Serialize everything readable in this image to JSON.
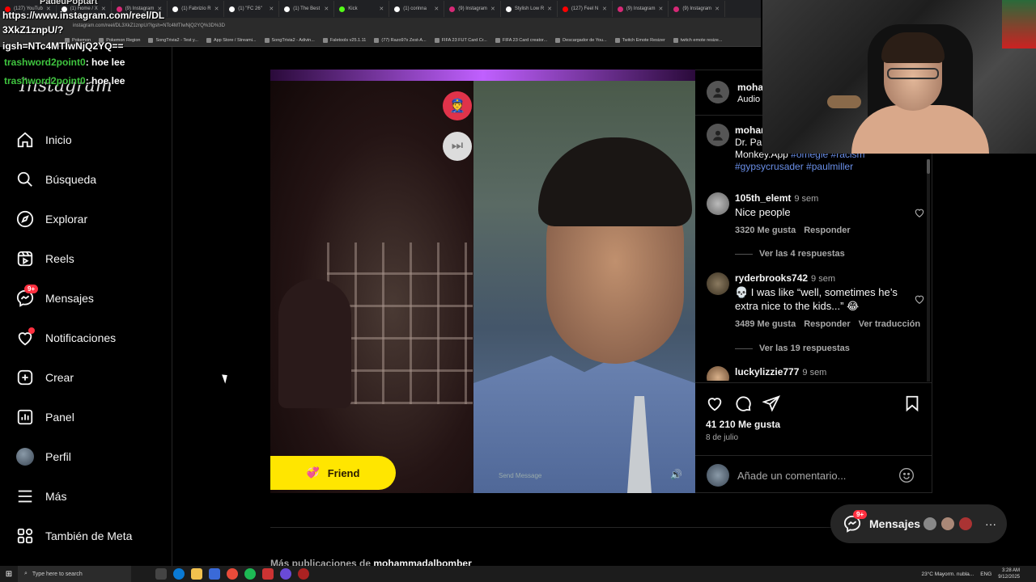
{
  "browser": {
    "tabs": [
      {
        "label": "(127) YouTub",
        "color": "#ff0000"
      },
      {
        "label": "(1) Home / X",
        "color": "#ffffff"
      },
      {
        "label": "(9) Instagram",
        "color": "#d62976"
      },
      {
        "label": "(1) Fabrizio R",
        "color": "#ffffff"
      },
      {
        "label": "(1) \"FC 26\"",
        "color": "#ffffff"
      },
      {
        "label": "(1) The Best",
        "color": "#ffffff"
      },
      {
        "label": "Kick",
        "color": "#53fc18"
      },
      {
        "label": "(1) corinna",
        "color": "#ffffff"
      },
      {
        "label": "(9) Instagram",
        "color": "#d62976"
      },
      {
        "label": "Stylish Low R",
        "color": "#ffffff"
      },
      {
        "label": "(127) Feel N",
        "color": "#ff0000"
      },
      {
        "label": "(9) Instagram",
        "color": "#d62976"
      },
      {
        "label": "(9) Instagram",
        "color": "#d62976"
      }
    ],
    "url": "instagram.com/reel/DL3XkZ1znpU/?igsh=NTc4MTIwNjQ2YQ%3D%3D",
    "bookmarks": [
      "Pokemon",
      "Pokemon Region",
      "SongTrivia2 - Test y...",
      "App Store / Streami...",
      "SongTrivia2 - Adivin...",
      "Faletools v25.1.11",
      "(77) Razo97x Zest-A...",
      "FIFA 23 FUT Card Cr...",
      "FIFA 23 Card creator...",
      "Descargador de You...",
      "Twitch Emote Resizer",
      "twitch emote resize..."
    ]
  },
  "overlay": {
    "user": "PadeuPoptart",
    "url_line1": "https://www.instagram.com/reel/DL",
    "url_line2": "3XkZ1znpU/?",
    "url_line3": "igsh=NTc4MTIwNjQ2YQ==",
    "chat": [
      {
        "name": "trashword2point0",
        "msg": ": hoe lee"
      },
      {
        "name": "trashword2point0",
        "msg": ": hoe lee"
      }
    ]
  },
  "sidebar": {
    "logo": "Instagram",
    "items": [
      {
        "label": "Inicio",
        "icon": "home-icon"
      },
      {
        "label": "Búsqueda",
        "icon": "search-icon"
      },
      {
        "label": "Explorar",
        "icon": "compass-icon"
      },
      {
        "label": "Reels",
        "icon": "reels-icon"
      },
      {
        "label": "Mensajes",
        "icon": "messenger-icon",
        "badge": "9+"
      },
      {
        "label": "Notificaciones",
        "icon": "heart-icon"
      },
      {
        "label": "Crear",
        "icon": "plus-square-icon"
      },
      {
        "label": "Panel",
        "icon": "chart-icon"
      },
      {
        "label": "Perfil",
        "icon": "avatar"
      },
      {
        "label": "Más",
        "icon": "menu-icon"
      },
      {
        "label": "También de Meta",
        "icon": "meta-grid-icon"
      }
    ]
  },
  "video": {
    "friend_label": "Friend",
    "send_placeholder": "Send Message",
    "police_icon": "police-emoji-icon",
    "skip_icon": "skip-icon"
  },
  "post": {
    "author": "moha",
    "audio": "Audio",
    "caption_user": "mohan",
    "caption_line1": "Dr. Pa",
    "caption_line2": "Monkey.App",
    "hashtags_line2": "#omegle #racism",
    "hashtags_line3": "#gypsycrusader #paulmiller",
    "comments": [
      {
        "user": "105th_elemt",
        "time": "9 sem",
        "text": "Nice people",
        "likes": "3320 Me gusta",
        "reply": "Responder",
        "translate": "",
        "replies": "Ver las 4 respuestas"
      },
      {
        "user": "ryderbrooks742",
        "time": "9 sem",
        "text": "💀 I was like “well, sometimes he’s extra nice to the kids...” 😂",
        "likes": "3489 Me gusta",
        "reply": "Responder",
        "translate": "Ver traducción",
        "replies": "Ver las 19 respuestas"
      },
      {
        "user": "luckylizzie777",
        "time": "9 sem",
        "text": "",
        "likes": "",
        "reply": "",
        "translate": "",
        "replies": ""
      }
    ],
    "total_likes": "41 210 Me gusta",
    "date": "8 de julio",
    "comment_placeholder": "Añade un comentario..."
  },
  "bottom": {
    "more_prefix": "Más publicaciones de",
    "more_user": "mohammadalbomber",
    "messages_label": "Mensajes",
    "messages_badge": "9+"
  },
  "taskbar": {
    "search_placeholder": "Type here to search",
    "weather": "23°C  Mayorm. nubla...",
    "lang": "ENG",
    "time": "3:28 AM",
    "date": "9/12/2025"
  },
  "colors": {
    "accent_red": "#ff3040",
    "hashtag_blue": "#6a8fe8",
    "friend_yellow": "#ffe600",
    "chat_name_green": "#3fc43f"
  }
}
